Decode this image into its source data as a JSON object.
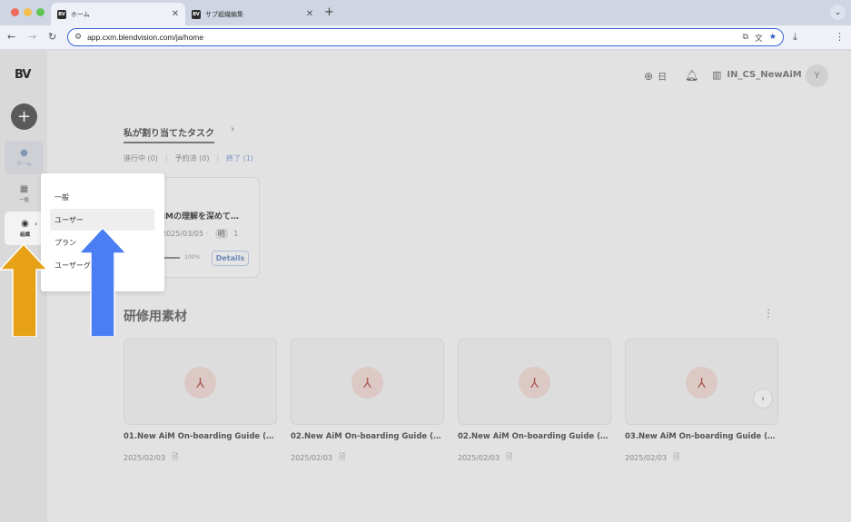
{
  "browser": {
    "tabs": [
      {
        "title": "ホーム",
        "favicon": "BV",
        "active": true
      },
      {
        "title": "サブ組織編集",
        "favicon": "BV",
        "active": false
      }
    ],
    "url": "app.cxm.blendvision.com/ja/home",
    "new_tab": "+",
    "traffic_colors": [
      "#ee6a5f",
      "#f5bf4f",
      "#61c454"
    ]
  },
  "sidebar": {
    "logo": "BV",
    "add_button": "+",
    "items": [
      {
        "label": "ホーム",
        "icon": "home-icon"
      },
      {
        "label": "一般",
        "icon": "grid-icon"
      },
      {
        "label": "組織",
        "icon": "organization-icon"
      }
    ]
  },
  "header": {
    "language": "日",
    "org_name": "IN_CS_NewAiM",
    "avatar": "Y"
  },
  "tasks": {
    "title": "私が割り当てたタスク",
    "tabs": [
      "進行中 (0)",
      "予約済 (0)",
      "終了 (1)"
    ],
    "card": {
      "name": "AiMの理解を深めて…",
      "date": "2025/03/05",
      "badge": "明",
      "count": "1",
      "progress_label": "100%",
      "progress": 1.0,
      "details_label": "Details"
    }
  },
  "materials": {
    "title": "研修用素材",
    "items": [
      {
        "name": "01.New AiM On-boarding Guide (Crea…",
        "date": "2025/02/03"
      },
      {
        "name": "02.New AiM On-boarding Guide (For …",
        "date": "2025/02/03"
      },
      {
        "name": "02.New AiM On-boarding Guide (For …",
        "date": "2025/02/03"
      },
      {
        "name": "03.New AiM On-boarding Guide (For …",
        "date": "2025/02/03"
      }
    ]
  },
  "popup_menu": {
    "items": [
      "一般",
      "ユーザー",
      "プラン",
      "ユーザーグ"
    ]
  },
  "annotation_colors": {
    "orange_arrow": "#e6a117",
    "blue_arrow": "#4a7ef2"
  }
}
